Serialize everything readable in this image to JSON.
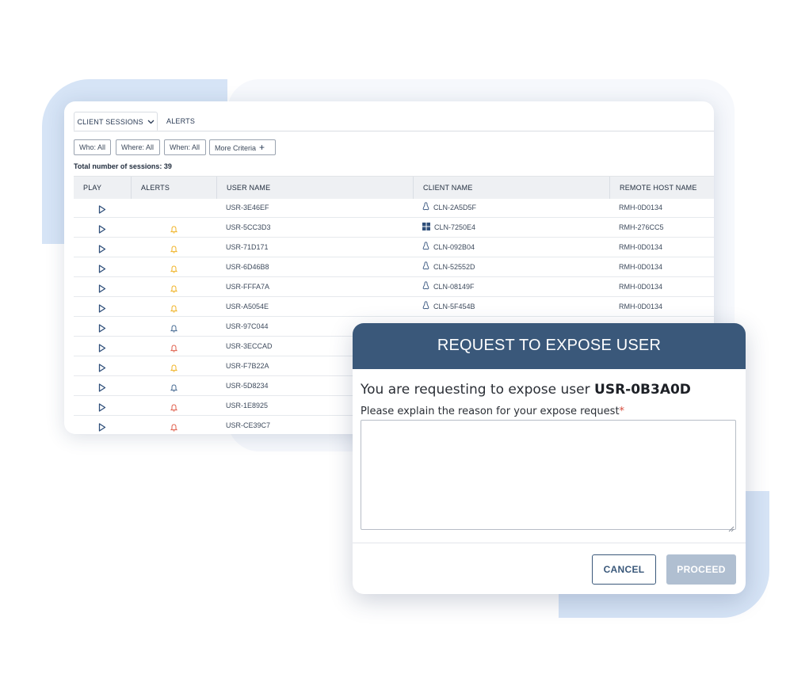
{
  "tabs": {
    "client_sessions": "CLIENT SESSIONS",
    "alerts": "ALERTS"
  },
  "filters": {
    "who": "Who: All",
    "where": "Where: All",
    "when": "When: All",
    "more": "More Criteria"
  },
  "total_sessions": "Total number of sessions: 39",
  "table": {
    "headers": [
      "PLAY",
      "ALERTS",
      "USER NAME",
      "CLIENT NAME",
      "REMOTE HOST NAME"
    ],
    "rows": [
      {
        "alert": "",
        "user": "USR-3E46EF",
        "os": "linux",
        "client": "CLN-2A5D5F",
        "host": "RMH-0D0134"
      },
      {
        "alert": "yellow",
        "user": "USR-5CC3D3",
        "os": "windows",
        "client": "CLN-7250E4",
        "host": "RMH-276CC5"
      },
      {
        "alert": "yellow",
        "user": "USR-71D171",
        "os": "linux",
        "client": "CLN-092B04",
        "host": "RMH-0D0134"
      },
      {
        "alert": "yellow",
        "user": "USR-6D46B8",
        "os": "linux",
        "client": "CLN-52552D",
        "host": "RMH-0D0134"
      },
      {
        "alert": "yellow",
        "user": "USR-FFFA7A",
        "os": "linux",
        "client": "CLN-08149F",
        "host": "RMH-0D0134"
      },
      {
        "alert": "yellow",
        "user": "USR-A5054E",
        "os": "linux",
        "client": "CLN-5F454B",
        "host": "RMH-0D0134"
      },
      {
        "alert": "blue",
        "user": "USR-97C044",
        "os": "",
        "client": "",
        "host": ""
      },
      {
        "alert": "red",
        "user": "USR-3ECCAD",
        "os": "",
        "client": "",
        "host": ""
      },
      {
        "alert": "yellow",
        "user": "USR-F7B22A",
        "os": "",
        "client": "",
        "host": ""
      },
      {
        "alert": "blue",
        "user": "USR-5D8234",
        "os": "",
        "client": "",
        "host": ""
      },
      {
        "alert": "red",
        "user": "USR-1E8925",
        "os": "",
        "client": "",
        "host": ""
      },
      {
        "alert": "red",
        "user": "USR-CE39C7",
        "os": "",
        "client": "",
        "host": ""
      }
    ]
  },
  "colors": {
    "alert_yellow": "#f0b429",
    "alert_blue": "#4a6d95",
    "alert_red": "#e0624f",
    "modal_header": "#3a587a",
    "play": "#2f4f7a"
  },
  "icons": {
    "play": "play-icon",
    "alert": "bell-icon",
    "linux": "linux-icon",
    "windows": "windows-icon",
    "dropdown": "chevron-down-icon",
    "add": "plus-icon"
  },
  "modal": {
    "title": "REQUEST TO EXPOSE USER",
    "prompt_prefix": "You are requesting to expose user ",
    "user": "USR-0B3A0D",
    "reason_label": "Please explain the reason for your expose request",
    "required_mark": "*",
    "reason_value": "",
    "cancel_label": "CANCEL",
    "proceed_label": "PROCEED"
  }
}
